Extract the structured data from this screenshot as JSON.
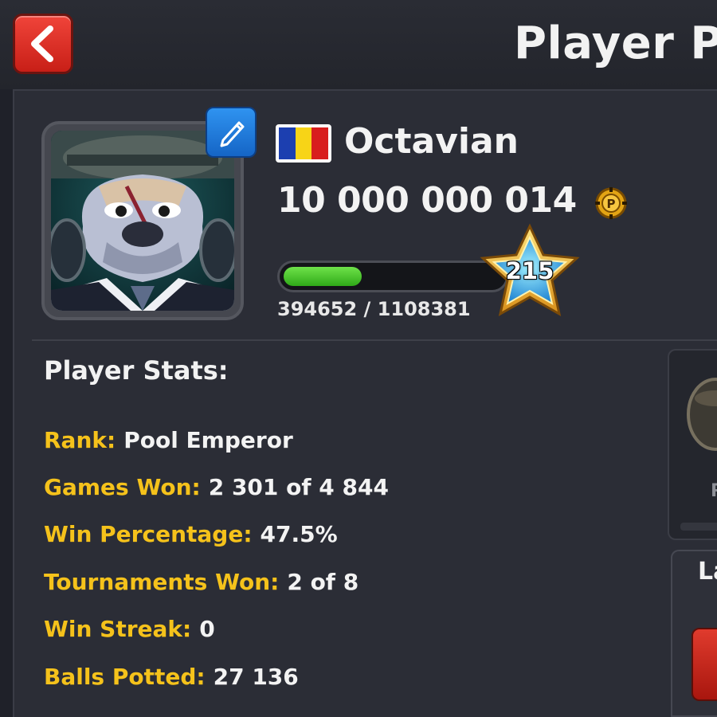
{
  "header": {
    "title": "Player Pr"
  },
  "profile": {
    "name": "Octavian",
    "country_flag_colors": [
      "#1c3fb0",
      "#f7d417",
      "#d81e1e"
    ],
    "coins": "10 000 000 014",
    "level": "215",
    "xp_text": "394652 / 1108381",
    "xp_progress": 0.356
  },
  "stats": {
    "title": "Player Stats:",
    "rows": [
      {
        "label": "Rank:",
        "value": "Pool Emperor"
      },
      {
        "label": "Games Won:",
        "value": "2 301 of 4 844"
      },
      {
        "label": "Win Percentage:",
        "value": "47.5%"
      },
      {
        "label": "Tournaments Won:",
        "value": "2 of 8"
      },
      {
        "label": "Win Streak:",
        "value": "0"
      },
      {
        "label": "Balls Potted:",
        "value": "27 136"
      }
    ]
  },
  "side": {
    "card_letter": "R",
    "card2_title": "La"
  },
  "colors": {
    "accent_yellow": "#f5c21b",
    "back_red": "#e0332a",
    "edit_blue": "#1f7fe0",
    "xp_green": "#3fc322"
  },
  "icons": [
    "back-arrow-icon",
    "pencil-icon",
    "coin-icon",
    "level-star-icon"
  ]
}
